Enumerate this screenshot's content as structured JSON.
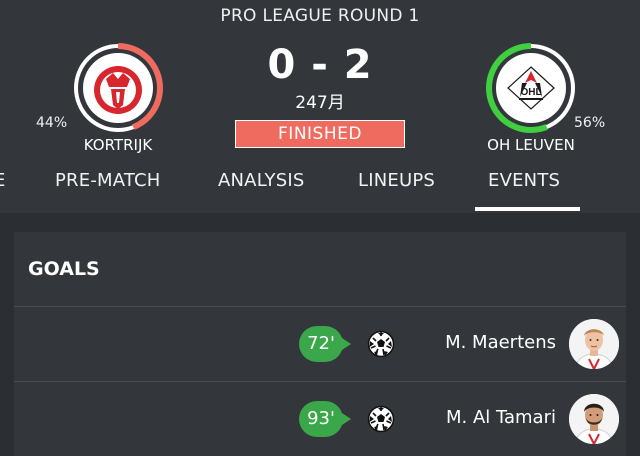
{
  "match": {
    "round": "PRO LEAGUE ROUND 1",
    "score": "0 - 2",
    "minute": "247月",
    "status": "FINISHED"
  },
  "home": {
    "name": "KORTRIJK",
    "possession": "44%",
    "possession_value": 0.44,
    "ring_color": "#ef6b60"
  },
  "away": {
    "name": "OH LEUVEN",
    "possession": "56%",
    "possession_value": 0.56,
    "ring_color": "#3fcf3f",
    "logo_text": "OHL"
  },
  "tabs": [
    "E",
    "PRE-MATCH",
    "ANALYSIS",
    "LINEUPS",
    "EVENTS"
  ],
  "active_tab": "EVENTS",
  "goals": {
    "title": "GOALS",
    "events": [
      {
        "minute": "72'",
        "player": "M. Maertens",
        "icon": "soccer-ball-icon"
      },
      {
        "minute": "93'",
        "player": "M. Al Tamari",
        "icon": "soccer-ball-icon"
      }
    ]
  },
  "colors": {
    "background": "#2b2e33",
    "header": "#33373c",
    "finished": "#ef6b60",
    "goal_badge": "#3aa84a"
  }
}
